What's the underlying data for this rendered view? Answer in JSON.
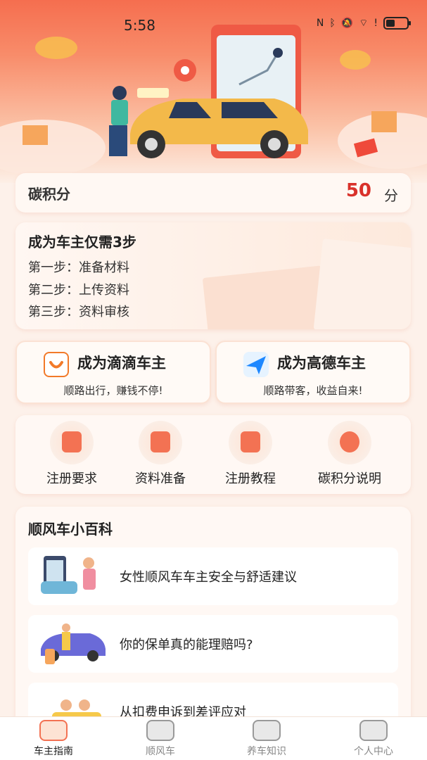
{
  "status": {
    "time": "5:58"
  },
  "carbon": {
    "label": "碳积分",
    "value": "50",
    "unit": "分"
  },
  "steps": {
    "title": "成为车主仅需3步",
    "items": [
      "第一步：准备材料",
      "第二步：上传资料",
      "第三步：资料审核"
    ]
  },
  "drivers": [
    {
      "title": "成为滴滴车主",
      "subtitle": "顺路出行，赚钱不停!"
    },
    {
      "title": "成为高德车主",
      "subtitle": "顺路带客，收益自来!"
    }
  ],
  "quick": [
    {
      "label": "注册要求",
      "icon": "user-plus-icon"
    },
    {
      "label": "资料准备",
      "icon": "document-icon"
    },
    {
      "label": "注册教程",
      "icon": "tutorial-icon"
    },
    {
      "label": "碳积分说明",
      "icon": "medal-icon"
    }
  ],
  "wiki": {
    "title": "顺风车小百科",
    "items": [
      {
        "text": "女性顺风车车主安全与舒适建议"
      },
      {
        "text": "你的保单真的能理赔吗?"
      },
      {
        "text": "从扣费申诉到差评应对"
      }
    ]
  },
  "tabs": [
    {
      "label": "车主指南",
      "icon": "car-icon",
      "active": true
    },
    {
      "label": "顺风车",
      "icon": "carpool-icon",
      "active": false
    },
    {
      "label": "养车知识",
      "icon": "book-icon",
      "active": false
    },
    {
      "label": "个人中心",
      "icon": "profile-icon",
      "active": false
    }
  ],
  "colors": {
    "accent": "#f37253",
    "points": "#d9312a",
    "hero": "#f56e4f"
  }
}
